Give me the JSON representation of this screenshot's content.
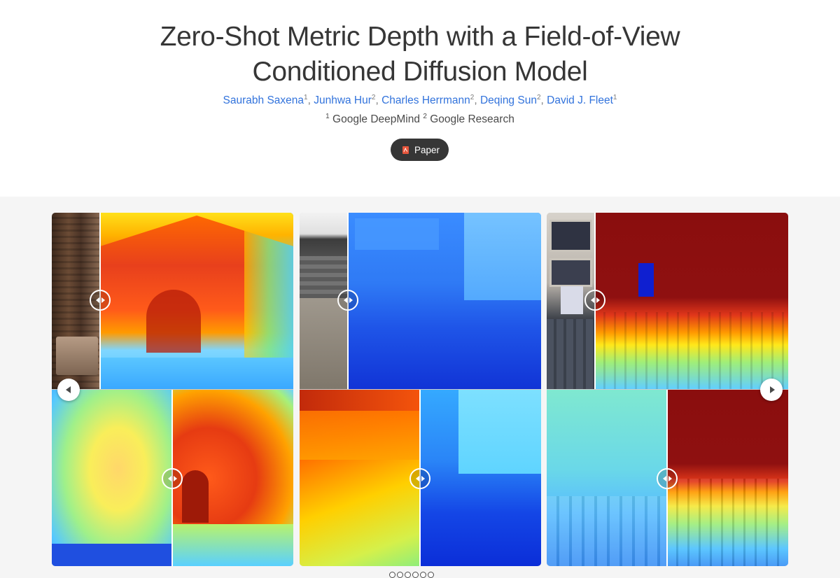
{
  "header": {
    "title_line1": "Zero-Shot Metric Depth with a Field-of-View",
    "title_line2": "Conditioned Diffusion Model",
    "authors": [
      {
        "name": "Saurabh Saxena",
        "sup": "1",
        "sep": ", "
      },
      {
        "name": "Junhwa Hur",
        "sup": "2",
        "sep": ", "
      },
      {
        "name": "Charles Herrmann",
        "sup": "2",
        "sep": ", "
      },
      {
        "name": "Deqing Sun",
        "sup": "2",
        "sep": ", "
      },
      {
        "name": "David J. Fleet",
        "sup": "1",
        "sep": ""
      }
    ],
    "affiliations": [
      {
        "sup": "1",
        "name": "Google DeepMind"
      },
      {
        "sup": "2",
        "name": "Google Research"
      }
    ],
    "paper_button": {
      "label": "Paper",
      "icon": "pdf-icon"
    }
  },
  "colors": {
    "accent": "#3273dc",
    "title": "#363636",
    "button_bg": "#363636",
    "gallery_bg": "#f5f5f5"
  },
  "carousel": {
    "prev_icon": "chevron-left-icon",
    "next_icon": "chevron-right-icon",
    "slide_count": 6,
    "active_slide": 0,
    "comparisons": [
      {
        "scene": "living room",
        "top": "rgb image vs predicted depth",
        "bottom": "ground-truth depth vs predicted depth"
      },
      {
        "scene": "outdoor street",
        "top": "rgb image vs predicted depth",
        "bottom": "ground-truth depth vs predicted depth"
      },
      {
        "scene": "auditorium",
        "top": "rgb image vs predicted depth",
        "bottom": "ground-truth depth vs predicted depth"
      }
    ]
  }
}
